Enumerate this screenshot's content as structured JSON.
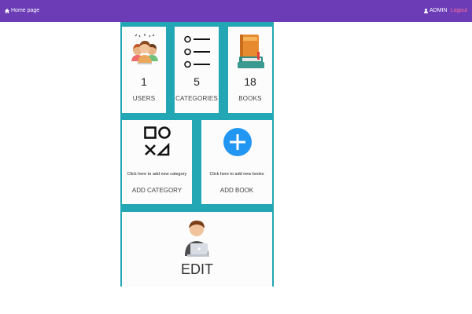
{
  "navbar": {
    "home_label": "Home page",
    "admin_label": "ADMIN",
    "logout_label": "Logout",
    "background": "#6b3cb5",
    "logout_color": "#ff6fa0"
  },
  "dashboard": {
    "panel_color": "#24a7b5",
    "stats": [
      {
        "count": "1",
        "label": "USERS",
        "icon": "users-group-icon"
      },
      {
        "count": "5",
        "label": "CATEGORIES",
        "icon": "list-icon"
      },
      {
        "count": "18",
        "label": "BOOKS",
        "icon": "books-icon"
      }
    ],
    "actions": [
      {
        "hint": "Click here to add new category",
        "label": "ADD CATEGORY",
        "icon": "shapes-icon"
      },
      {
        "hint": "Click here to add new books",
        "label": "ADD BOOK",
        "icon": "plus-circle-icon",
        "accent": "#2196f3"
      }
    ],
    "edit": {
      "label": "EDIT",
      "icon": "person-laptop-icon"
    }
  }
}
